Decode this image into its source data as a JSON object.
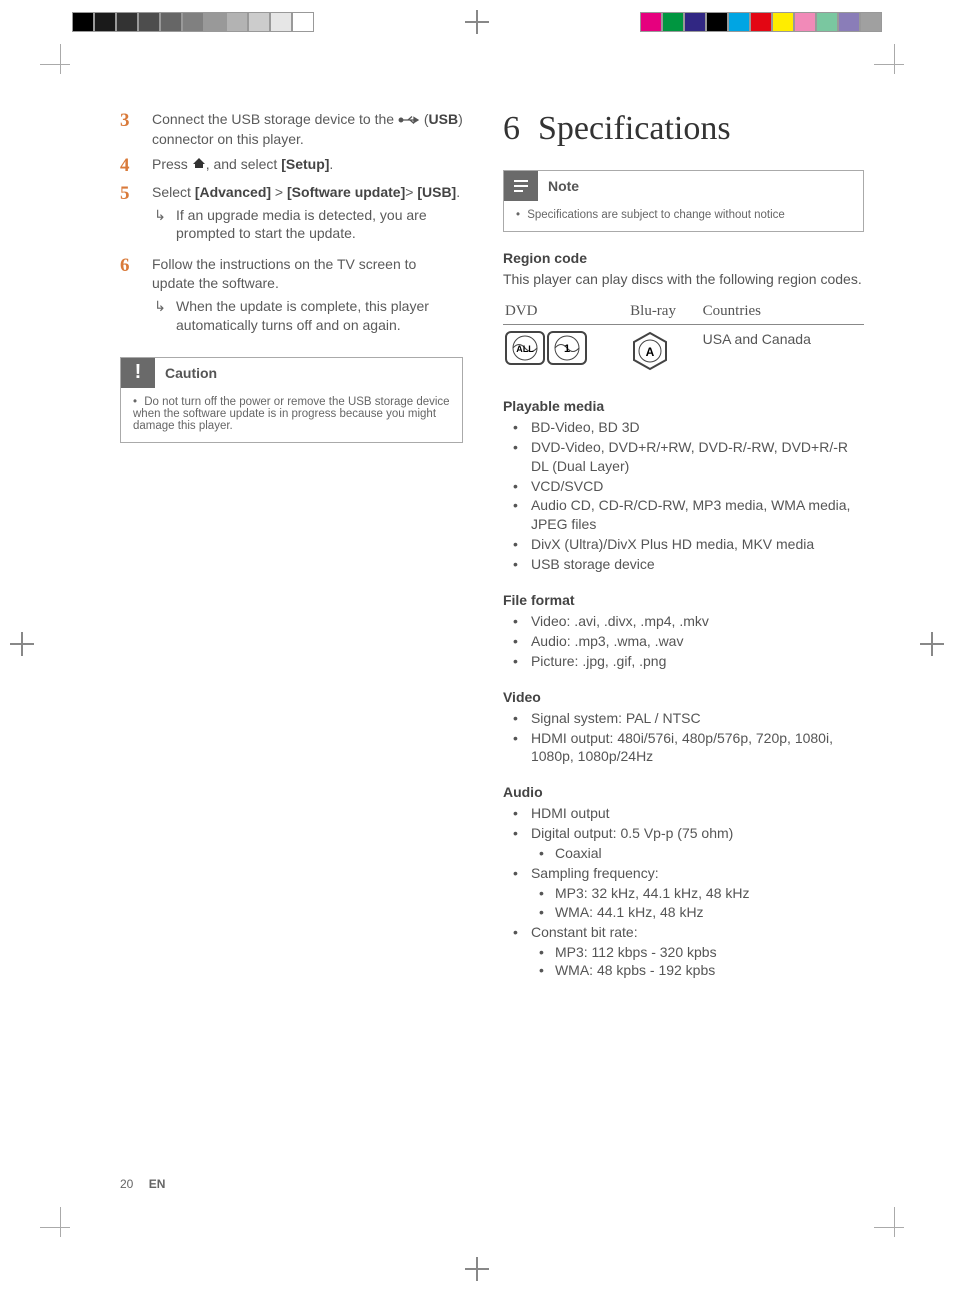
{
  "leftColumn": {
    "steps": [
      {
        "n": "3",
        "text_parts": [
          "Connect the USB storage device to the ",
          " (",
          "USB",
          ") connector on this player."
        ],
        "has_usb_icon": true
      },
      {
        "n": "4",
        "text_parts": [
          "Press ",
          ", and select ",
          "[Setup]",
          "."
        ],
        "has_home_icon": true
      },
      {
        "n": "5",
        "text_parts": [
          "Select ",
          "[Advanced]",
          " > ",
          "[Software update]",
          "> ",
          "[USB]",
          "."
        ],
        "sub": "If an upgrade media is detected, you are prompted to start the update."
      },
      {
        "n": "6",
        "text": "Follow the instructions on the TV screen to update the software.",
        "sub": "When the update is complete, this player automatically turns off and on again."
      }
    ],
    "caution": {
      "label": "Caution",
      "body": "Do not turn off the power or remove the USB storage device when the software update is in progress because you might damage this player."
    }
  },
  "rightColumn": {
    "chapterNum": "6",
    "chapterTitle": "Specifications",
    "note": {
      "label": "Note",
      "body": "Specifications are subject to change without notice"
    },
    "region": {
      "heading": "Region code",
      "intro": "This player can play discs with the following region codes.",
      "cols": [
        "DVD",
        "Blu-ray",
        "Countries"
      ],
      "row": {
        "countries": "USA and Canada"
      }
    },
    "sections": [
      {
        "heading": "Playable media",
        "items": [
          "BD-Video, BD 3D",
          "DVD-Video, DVD+R/+RW, DVD-R/-RW, DVD+R/-R DL (Dual Layer)",
          "VCD/SVCD",
          "Audio CD, CD-R/CD-RW, MP3 media, WMA media, JPEG files",
          "DivX (Ultra)/DivX Plus HD media, MKV media",
          "USB storage device"
        ]
      },
      {
        "heading": "File format",
        "items": [
          "Video: .avi, .divx, .mp4, .mkv",
          "Audio: .mp3, .wma, .wav",
          "Picture: .jpg, .gif, .png"
        ]
      },
      {
        "heading": "Video",
        "items": [
          "Signal system: PAL / NTSC",
          "HDMI output: 480i/576i, 480p/576p, 720p, 1080i, 1080p, 1080p/24Hz"
        ]
      },
      {
        "heading": "Audio",
        "items": [
          "HDMI output",
          {
            "text": "Digital output: 0.5 Vp-p (75 ohm)",
            "sub": [
              "Coaxial"
            ]
          },
          {
            "text": "Sampling frequency:",
            "sub": [
              "MP3: 32 kHz, 44.1 kHz, 48 kHz",
              "WMA: 44.1 kHz, 48 kHz"
            ]
          },
          {
            "text": "Constant bit rate:",
            "sub": [
              "MP3: 112 kbps - 320 kpbs",
              "WMA: 48 kpbs - 192 kpbs"
            ]
          }
        ]
      }
    ]
  },
  "footer": {
    "page": "20",
    "lang": "EN"
  }
}
